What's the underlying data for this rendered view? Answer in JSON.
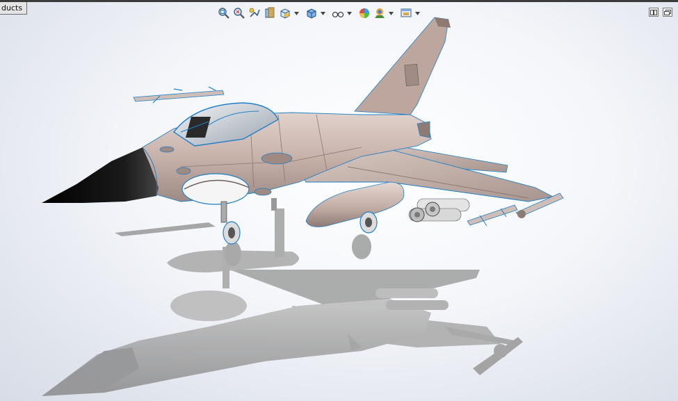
{
  "tab": {
    "label": "ducts"
  },
  "heads_up_toolbar": [
    {
      "icon": "zoom-to-fit-icon",
      "dropdown": false
    },
    {
      "icon": "zoom-to-area-icon",
      "dropdown": false
    },
    {
      "icon": "previous-view-icon",
      "dropdown": false
    },
    {
      "icon": "section-view-icon",
      "dropdown": false
    },
    {
      "icon": "view-orientation-icon",
      "dropdown": true
    },
    {
      "icon": "display-style-icon",
      "dropdown": true
    },
    {
      "icon": "hide-show-items-icon",
      "dropdown": true
    },
    {
      "icon": "edit-appearance-icon",
      "dropdown": false
    },
    {
      "icon": "apply-scene-icon",
      "dropdown": true
    },
    {
      "icon": "view-settings-icon",
      "dropdown": true
    }
  ],
  "window_controls": [
    {
      "icon": "tile-horizontally-icon"
    },
    {
      "icon": "restore-window-icon"
    }
  ],
  "colors": {
    "fuselage": "#c9b4ac",
    "edges": "#1e7fc8",
    "nose": "#0b0b0b",
    "shadow": "#9a9a9a"
  }
}
